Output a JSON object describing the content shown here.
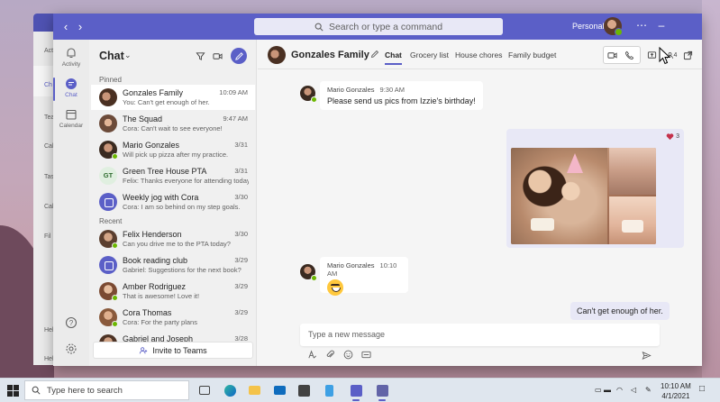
{
  "titlebar": {
    "search_placeholder": "Search or type a command",
    "account_label": "Personal"
  },
  "back_window": {
    "rail": [
      "Activ",
      "Ch",
      "Tea",
      "Calen",
      "Tas",
      "Cal",
      "Fil",
      "Hel",
      "Hel"
    ]
  },
  "rail": {
    "activity": "Activity",
    "chat": "Chat",
    "calendar": "Calendar"
  },
  "chat_list": {
    "title": "Chat",
    "pinned_label": "Pinned",
    "recent_label": "Recent",
    "pinned": [
      {
        "name": "Gonzales Family",
        "preview": "You: Can't get enough of her.",
        "time": "10:09 AM"
      },
      {
        "name": "The Squad",
        "preview": "Cora: Can't wait to see everyone!",
        "time": "9:47 AM"
      },
      {
        "name": "Mario Gonzales",
        "preview": "Will pick up pizza after my practice.",
        "time": "3/31"
      },
      {
        "name": "Green Tree House PTA",
        "preview": "Felix: Thanks everyone for attending today.",
        "time": "3/31",
        "initials": "GT"
      },
      {
        "name": "Weekly jog with Cora",
        "preview": "Cora: I am so behind on my step goals.",
        "time": "3/30"
      }
    ],
    "recent": [
      {
        "name": "Felix Henderson",
        "preview": "Can you drive me to the PTA today?",
        "time": "3/30"
      },
      {
        "name": "Book reading club",
        "preview": "Gabriel: Suggestions for the next book?",
        "time": "3/29"
      },
      {
        "name": "Amber Rodriguez",
        "preview": "That is awesome! Love it!",
        "time": "3/29"
      },
      {
        "name": "Cora Thomas",
        "preview": "Cora: For the party plans",
        "time": "3/29"
      },
      {
        "name": "Gabriel and Joseph",
        "preview": "",
        "time": "3/28"
      },
      {
        "name": "",
        "preview": "",
        "time": "3/28"
      }
    ],
    "invite_label": "Invite to Teams"
  },
  "conversation": {
    "title": "Gonzales Family",
    "tabs": [
      "Chat",
      "Grocery list",
      "House chores",
      "Family budget"
    ],
    "participant_count": "4",
    "messages": [
      {
        "sender": "Mario Gonzales",
        "time": "9:30 AM",
        "text": "Please send us pics from Izzie's birthday!"
      },
      {
        "sender": "Mario Gonzales",
        "time": "10:10 AM",
        "text": ""
      }
    ],
    "photo_reaction_count": "3",
    "my_message": "Can't get enough of her.",
    "compose_placeholder": "Type a new message"
  },
  "taskbar": {
    "search_placeholder": "Type here to search",
    "time": "10:10 AM",
    "date": "4/1/2021"
  },
  "colors": {
    "brand": "#5b5fc7",
    "presence_available": "#6bb700"
  }
}
